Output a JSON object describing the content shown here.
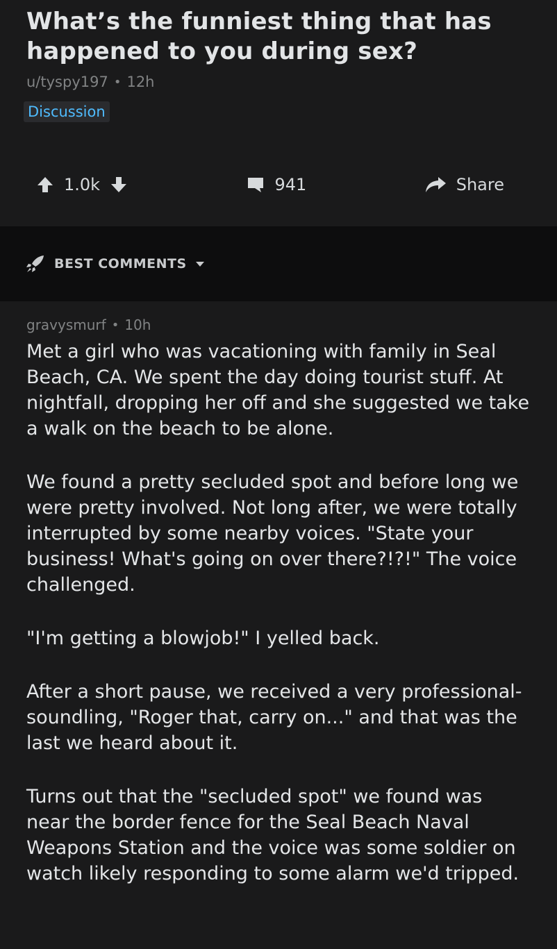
{
  "post": {
    "title": "What’s the funniest thing that has happened to you during sex?",
    "author": "u/tyspy197",
    "separator": "•",
    "time": "12h",
    "flair": "Discussion",
    "score": "1.0k",
    "comments": "941",
    "share_label": "Share"
  },
  "sort": {
    "label": "BEST COMMENTS"
  },
  "comment": {
    "author": "gravysmurf",
    "separator": "•",
    "time": "10h",
    "paragraphs": [
      "Met a girl who was vacationing with family in Seal Beach, CA.  We spent the day doing tourist stuff.  At nightfall, dropping her off and she suggested we take a walk on the beach to be alone.",
      "We found a pretty secluded spot and before long we were pretty involved.  Not long after, we were totally interrupted by some nearby voices.  \"State your business!  What's going on over there?!?!\" The voice challenged.",
      "\"I'm getting a blowjob!\" I yelled back.",
      "After a short pause, we received a very professional-soundling, \"Roger that, carry on...\" and that was the last we heard about it.",
      "Turns out that the \"secluded spot\" we found was near the border fence for the Seal Beach Naval Weapons Station and the voice was some soldier on watch likely responding to some alarm we'd tripped."
    ]
  },
  "icons": {
    "upvote": "upvote-icon",
    "downvote": "downvote-icon",
    "comment": "comment-icon",
    "share": "share-icon",
    "sort": "rocket-icon",
    "dropdown": "caret-down-icon"
  },
  "colors": {
    "background": "#1a1a1b",
    "sort_bar": "#0d0d0e",
    "flair_text": "#4fbcff",
    "meta_text": "#818384"
  }
}
